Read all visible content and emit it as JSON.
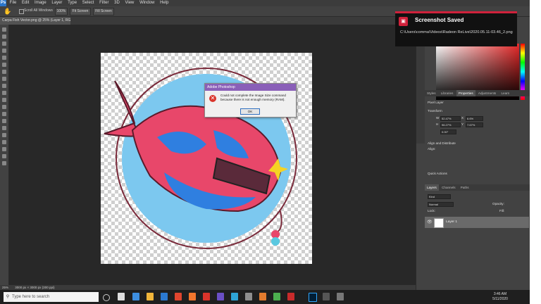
{
  "app": {
    "logo": "Ps",
    "menu": [
      "File",
      "Edit",
      "Image",
      "Layer",
      "Type",
      "Select",
      "Filter",
      "3D",
      "View",
      "Window",
      "Help"
    ]
  },
  "options_bar": {
    "scroll_all_windows": "Scroll All Windows",
    "zoom": "100%",
    "fit_screen": "Fit Screen",
    "fill_screen": "Fill Screen"
  },
  "document": {
    "tab_title": "Carpa Fish Vector.png @ 25% (Layer 1, RGB/8)",
    "zoom_status": "25%",
    "size_status": "3000 px × 3000 px (300 ppi)"
  },
  "dialog": {
    "title": "Adobe Photoshop",
    "message": "Could not complete the Image Size command because there is not enough memory (RAM).",
    "ok": "OK"
  },
  "panels": {
    "props_tabs": [
      "Styles",
      "Libraries",
      "Properties",
      "Adjustments",
      "Learn"
    ],
    "pixel_layer": "Pixel Layer",
    "transform": "Transform",
    "w": "W",
    "h": "H",
    "x": "X",
    "y": "Y",
    "w_val": "52.47%",
    "h_val": "96.27%",
    "x_val": "6.6%",
    "y_val": "7.67%",
    "angle": "0.00°",
    "align": "Align and Distribute",
    "align_label": "Align:",
    "quick": "Quick Actions",
    "layer_tabs": [
      "Layers",
      "Channels",
      "Paths"
    ],
    "kind": "Kind",
    "normal": "Normal",
    "opacity": "Opacity:",
    "lock": "Lock:",
    "fill": "Fill:",
    "layer_name": "Layer 1"
  },
  "notification": {
    "title": "Screenshot Saved",
    "path": "C:\\Users\\comma\\Videos\\Radeon ReLive\\2020.05.11-03.46_2.png"
  },
  "taskbar": {
    "search_placeholder": "Type here to search",
    "time": "3:46 AM",
    "date": "5/11/2020"
  },
  "colors": {
    "accent_dialog": "#8a5fb8",
    "toast_accent": "#d0213b",
    "fish_pink": "#e8476a",
    "fish_blue": "#2f7fe0",
    "circle_blue": "#7cc8ef"
  }
}
